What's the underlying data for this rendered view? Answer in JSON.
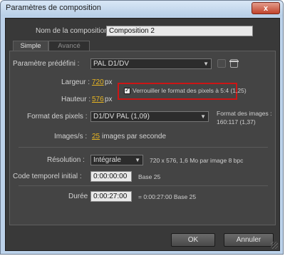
{
  "window": {
    "title": "Paramètres de composition",
    "close_label": "x"
  },
  "comp_name": {
    "label": "Nom de la composition :",
    "value": "Composition 2"
  },
  "tabs": [
    {
      "label": "Simple"
    },
    {
      "label": "Avancé"
    }
  ],
  "preset": {
    "label": "Paramètre prédéfini :",
    "value": "PAL D1/DV"
  },
  "width": {
    "label": "Largeur :",
    "value": "720",
    "unit": "px"
  },
  "height": {
    "label": "Hauteur :",
    "value": "576",
    "unit": "px"
  },
  "lock_aspect": {
    "label": "Verrouiller le format des pixels à 5:4 (1,25)",
    "checked": true
  },
  "pixel_aspect": {
    "label": "Format des pixels :",
    "value": "D1/DV PAL (1,09)"
  },
  "frame_aspect": {
    "label": "Format des images :",
    "value": "160:117 (1,37)"
  },
  "fps": {
    "label": "Images/s :",
    "value": "25",
    "suffix": "images par seconde"
  },
  "resolution": {
    "label": "Résolution :",
    "value": "Intégrale",
    "info": "720 x 576, 1,6 Mo par image 8 bpc"
  },
  "start_timecode": {
    "label": "Code temporel initial :",
    "value": "0:00:00:00",
    "info": "Base 25"
  },
  "duration": {
    "label": "Durée :",
    "value": "0:00:27:00",
    "info": "= 0:00:27:00  Base 25"
  },
  "buttons": {
    "ok": "OK",
    "cancel": "Annuler"
  },
  "colors": {
    "accent_value": "#e6b422",
    "highlight_box": "#cc1515"
  }
}
